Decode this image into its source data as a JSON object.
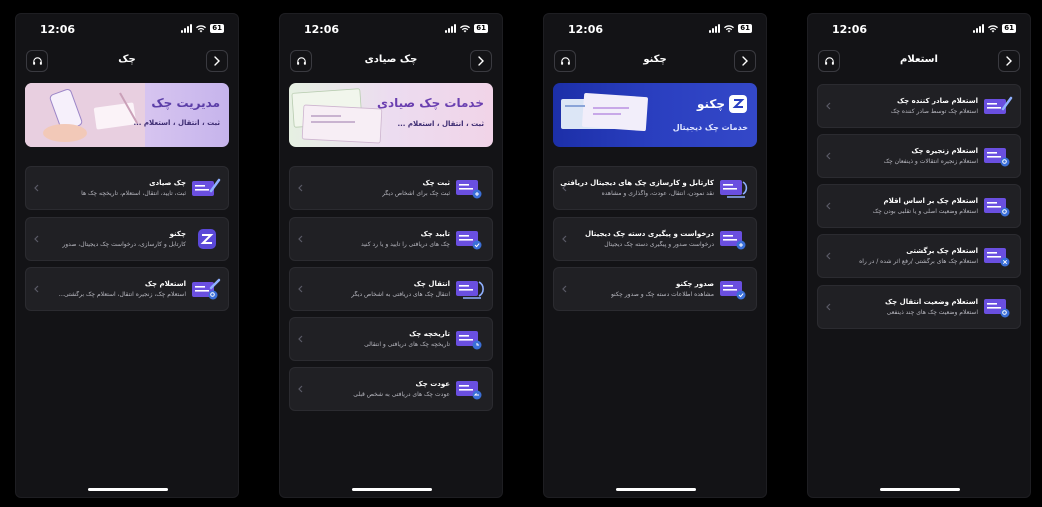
{
  "screens": [
    {
      "time": "12:06",
      "battery": "61",
      "title": "چک",
      "banner": {
        "title": "مدیریت چک",
        "subtitle": "ثبت ، انتقال ، استعلام ..."
      },
      "items": [
        {
          "title": "چک صیادی",
          "subtitle": "ثبت، تایید، انتقال، استعلام، تاریخچه چک ها"
        },
        {
          "title": "چکنو",
          "subtitle": "کارتابل و کارسازی، درخواست چک دیجیتال، صدور"
        },
        {
          "title": "استعلام چک",
          "subtitle": "استعلام چک، زنجیره انتقال، استعلام چک برگشتی..."
        }
      ]
    },
    {
      "time": "12:06",
      "battery": "61",
      "title": "چک صیادی",
      "banner": {
        "title": "خدمات چک صیادی",
        "subtitle": "ثبت ، انتقال ، استعلام ..."
      },
      "items": [
        {
          "title": "ثبت چک",
          "subtitle": "ثبت چک برای اشخاص دیگر"
        },
        {
          "title": "تایید چک",
          "subtitle": "چک های دریافتی را تایید و یا رد کنید"
        },
        {
          "title": "انتقال چک",
          "subtitle": "انتقال چک های دریافتی به اشخاص دیگر"
        },
        {
          "title": "تاریخچه چک",
          "subtitle": "تاریخچه چک های دریافتی و انتقالی"
        },
        {
          "title": "عودت چک",
          "subtitle": "عودت چک های دریافتی به شخص قبلی"
        }
      ]
    },
    {
      "time": "12:06",
      "battery": "61",
      "title": "چکنو",
      "banner": {
        "title": "چکنو",
        "subtitle": "خدمات چک دیجیتال"
      },
      "items": [
        {
          "title": "کارتابل و کارسازی چک های دیجیتال دریافتی",
          "subtitle": "نقد نمودن، انتقال، عودت، واگذاری و مشاهده"
        },
        {
          "title": "درخواست و پیگیری دسته چک دیجیتال",
          "subtitle": "درخواست صدور و پیگیری دسته چک دیجیتال"
        },
        {
          "title": "صدور چکنو",
          "subtitle": "مشاهده اطلاعات دسته چک و صدور چکنو"
        }
      ]
    },
    {
      "time": "12:06",
      "battery": "61",
      "title": "استعلام",
      "items": [
        {
          "title": "استعلام صادر کننده چک",
          "subtitle": "استعلام چک توسط صادر کننده چک"
        },
        {
          "title": "استعلام زنجیره چک",
          "subtitle": "استعلام زنجیره انتقالات و ذینفعان چک"
        },
        {
          "title": "استعلام چک بر اساس اقلام",
          "subtitle": "استعلام وضعیت اصلی و یا تقلبی بودن چک"
        },
        {
          "title": "استعلام چک برگشتی",
          "subtitle": "استعلام چک های برگشتی /رفع اثر شده / در راه"
        },
        {
          "title": "استعلام وضعیت انتقال چک",
          "subtitle": "استعلام وضعیت چک های چند ذینفعی"
        }
      ]
    }
  ],
  "colors": {
    "accent": "#7b4dff",
    "card": "#202024",
    "background": "#131316"
  }
}
